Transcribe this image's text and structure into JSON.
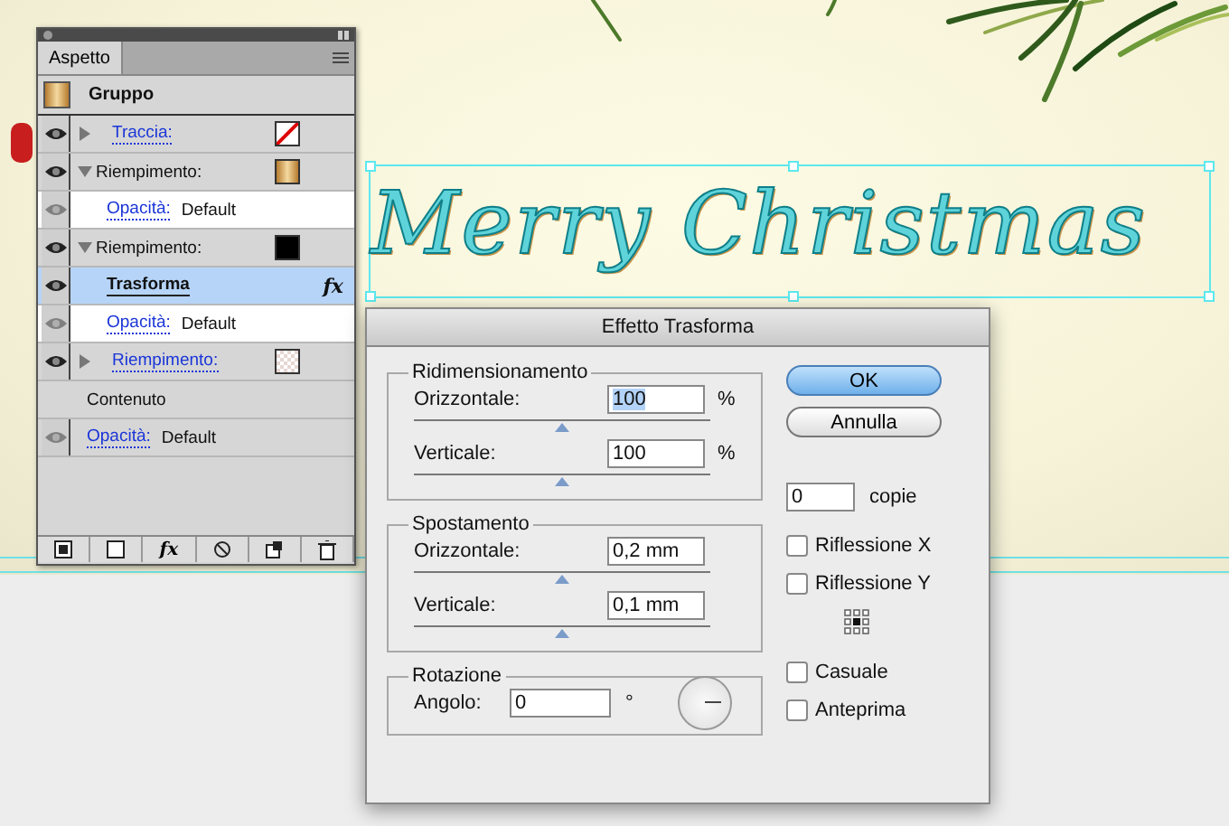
{
  "canvas": {
    "artwork_text": "Merry Christmas"
  },
  "panel": {
    "tab": "Aspetto",
    "header": "Gruppo",
    "rows": [
      {
        "kind": "attr",
        "label": "Traccia:",
        "expanded": false,
        "swatch": {
          "kind": "none"
        },
        "selected": false
      },
      {
        "kind": "attr",
        "label": "Riempimento:",
        "expanded": true,
        "swatch": {
          "kind": "gold"
        },
        "selected": false
      },
      {
        "kind": "opacity",
        "label": "Opacità:",
        "value": "Default",
        "selected": false
      },
      {
        "kind": "attr",
        "label": "Riempimento:",
        "expanded": true,
        "swatch": {
          "kind": "black"
        },
        "selected": false
      },
      {
        "kind": "effect",
        "label": "Trasforma",
        "badge": "fx",
        "selected": true
      },
      {
        "kind": "opacity",
        "label": "Opacità:",
        "value": "Default",
        "selected": false
      },
      {
        "kind": "attr",
        "label": "Riempimento:",
        "expanded": false,
        "swatch": {
          "kind": "pattern"
        },
        "selected": false
      },
      {
        "kind": "contents",
        "label": "Contenuto",
        "selected": false
      },
      {
        "kind": "top-opacity",
        "label": "Opacità:",
        "value": "Default",
        "selected": false
      }
    ],
    "toolbar": [
      {
        "kind": "stroke-fill"
      },
      {
        "kind": "fill"
      },
      {
        "kind": "fx",
        "label": "fx"
      },
      {
        "kind": "clear"
      },
      {
        "kind": "duplicate"
      },
      {
        "kind": "delete"
      }
    ]
  },
  "dialog": {
    "title": "Effetto Trasforma",
    "groups": [
      {
        "title": "Ridimensionamento",
        "fields": [
          {
            "label": "Orizzontale:",
            "value": "100",
            "unit": "%",
            "highlighted": true,
            "level": 0.5
          },
          {
            "label": "Verticale:",
            "value": "100",
            "unit": "%",
            "highlighted": false,
            "level": 0.5
          }
        ]
      },
      {
        "title": "Spostamento",
        "fields": [
          {
            "label": "Orizzontale:",
            "value": "0,2 mm",
            "highlighted": false,
            "level": 0.5
          },
          {
            "label": "Verticale:",
            "value": "0,1 mm",
            "highlighted": false,
            "level": 0.5
          }
        ]
      }
    ],
    "rotation": {
      "title": "Rotazione",
      "label": "Angolo:",
      "value": "0",
      "unit": "°"
    },
    "buttons": [
      {
        "label": "OK",
        "default": true
      },
      {
        "label": "Annulla",
        "default": false
      }
    ],
    "copies": {
      "value": "0",
      "label": "copie"
    },
    "options_top": [
      {
        "label": "Riflessione X",
        "checked": false
      },
      {
        "label": "Riflessione Y",
        "checked": false
      }
    ],
    "options_bottom": [
      {
        "label": "Casuale",
        "checked": false
      },
      {
        "label": "Anteprima",
        "checked": false
      }
    ]
  }
}
